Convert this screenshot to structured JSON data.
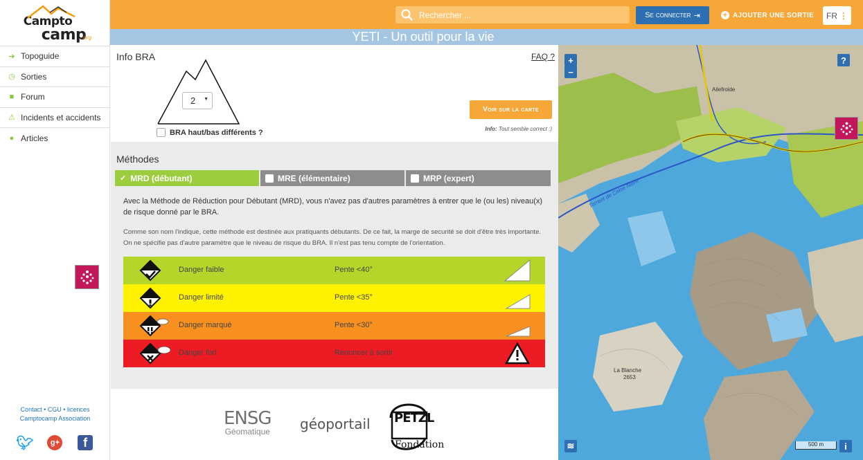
{
  "brand": {
    "name_top": "Campto",
    "name_bottom": "camp",
    "suffix": ".org"
  },
  "nav": {
    "items": [
      {
        "label": "Topoguide",
        "icon": "arrow-right-icon"
      },
      {
        "label": "Sorties",
        "icon": "clock-icon"
      },
      {
        "label": "Forum",
        "icon": "chat-icon"
      },
      {
        "label": "Incidents et accidents",
        "icon": "warning-icon"
      },
      {
        "label": "Articles",
        "icon": "info-icon"
      }
    ]
  },
  "footer_links": {
    "contact": "Contact",
    "cgu": "CGU",
    "licences": "licences",
    "association": "Camptocamp Association"
  },
  "topbar": {
    "search_placeholder": "Rechercher ...",
    "login": "Se connecter",
    "add_outing": "AJOUTER UNE SORTIE",
    "lang": "FR"
  },
  "banner": "YETI - Un outil pour la vie",
  "bra": {
    "title": "Info BRA",
    "faq": "FAQ ?",
    "selected_level": "2",
    "diff_label": "BRA haut/bas différents ?",
    "map_button": "Voir sur la carte",
    "info_prefix": "Info:",
    "info_text": "Tout semble correct :)"
  },
  "methods": {
    "title": "Méthodes",
    "tabs": [
      {
        "label": "MRD (débutant)",
        "active": true
      },
      {
        "label": "MRE (élémentaire)",
        "active": false
      },
      {
        "label": "MRP (expert)",
        "active": false
      }
    ],
    "description": "Avec la Méthode de Réduction pour Débutant (MRD), vous n'avez pas d'autres paramètres à entrer que le (ou les) niveau(x) de risque donné par le BRA.",
    "note": "Comme son nom l'indique, cette méthode est destinée aux pratiquants débutants. De ce fait, la marge de securité se doit d'être très importante. On ne spécifie pas d'autre paramètre que le niveau de risque du BRA. Il n'est pas tenu compte de l'orientation.",
    "danger_rows": [
      {
        "label": "Danger faible",
        "slope": "Pente <40°",
        "color": "#b5d52b"
      },
      {
        "label": "Danger limité",
        "slope": "Pente <35°",
        "color": "#fff200"
      },
      {
        "label": "Danger marqué",
        "slope": "Pente <30°",
        "color": "#f7901e"
      },
      {
        "label": "Danger fort",
        "slope": "Renoncer à sortir",
        "color": "#ed1c24"
      }
    ]
  },
  "sponsors": {
    "ensg_line1": "ENSG",
    "ensg_line2": "Géomatique",
    "geoportail": "géoportail",
    "petzl": "PETZL",
    "petzl_sub": "Fondation"
  },
  "map": {
    "zoom_in": "+",
    "zoom_out": "−",
    "help": "?",
    "info": "i",
    "scale": "500 m",
    "labels": {
      "ailefroide": "Ailefroide",
      "torrent": "Torrent de Celse Nière",
      "blanche": "La Blanche",
      "blanche_alt": "2653"
    }
  },
  "colors": {
    "orange": "#f7a737",
    "blue": "#2d6fb0",
    "green": "#9ccd3f",
    "banner": "#a5c6e3"
  }
}
